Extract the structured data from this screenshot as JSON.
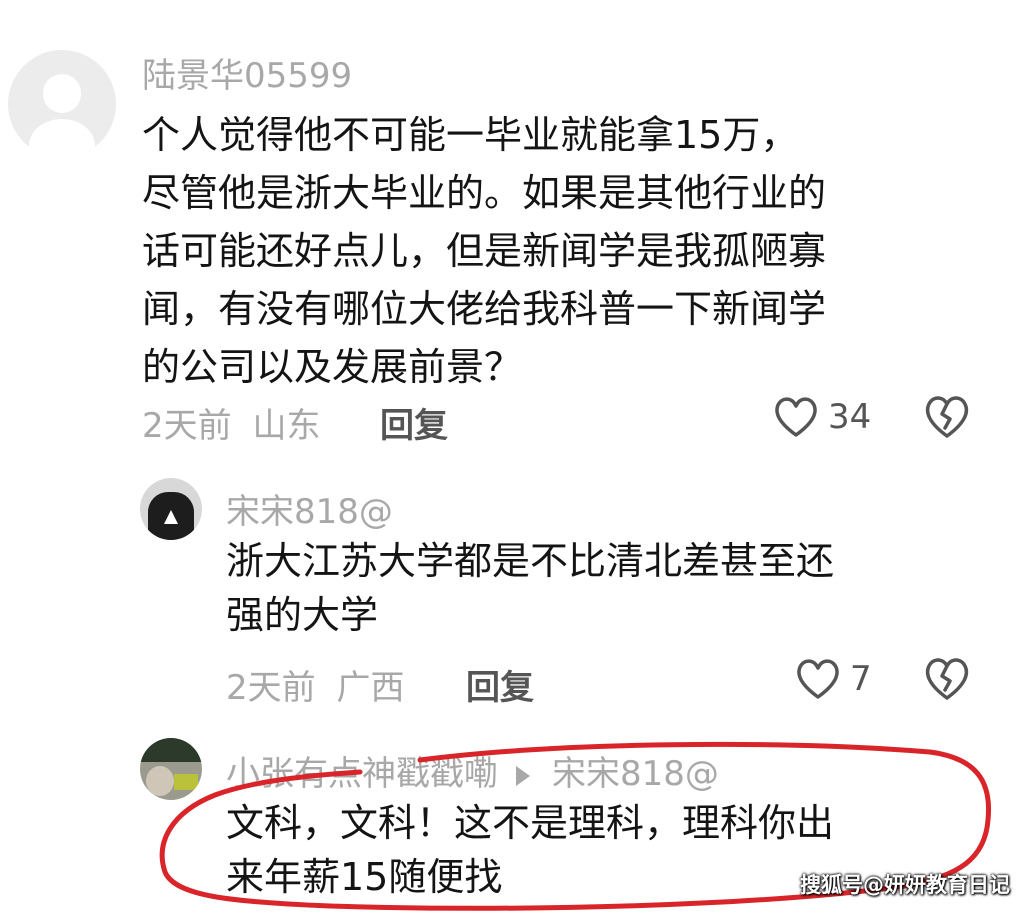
{
  "comments": [
    {
      "username": "陆景华05599",
      "text": "个人觉得他不可能一毕业就能拿15万，\n尽管他是浙大毕业的。如果是其他行业的\n话可能还好点儿，但是新闻学是我孤陋寡\n闻，有没有哪位大佬给我科普一下新闻学\n的公司以及发展前景？",
      "time": "2天前",
      "location": "山东",
      "reply_label": "回复",
      "likes": "34"
    },
    {
      "username": "宋宋818@",
      "text": "浙大江苏大学都是不比清北差甚至还\n强的大学",
      "time": "2天前",
      "location": "广西",
      "reply_label": "回复",
      "likes": "7"
    },
    {
      "username": "小张有点神戳戳嘞",
      "reply_to": "宋宋818@",
      "text": "文科，文科！这不是理科，理科你出\n来年薪15随便找"
    }
  ],
  "watermark": "搜狐号@妍妍教育日记",
  "colors": {
    "annotation_red": "#d9252a",
    "muted_text": "#a8a8a8",
    "body_text": "#141414"
  },
  "icons": {
    "like": "heart-outline-icon",
    "dislike": "broken-heart-icon",
    "reply_arrow": "triangle-right-icon"
  }
}
